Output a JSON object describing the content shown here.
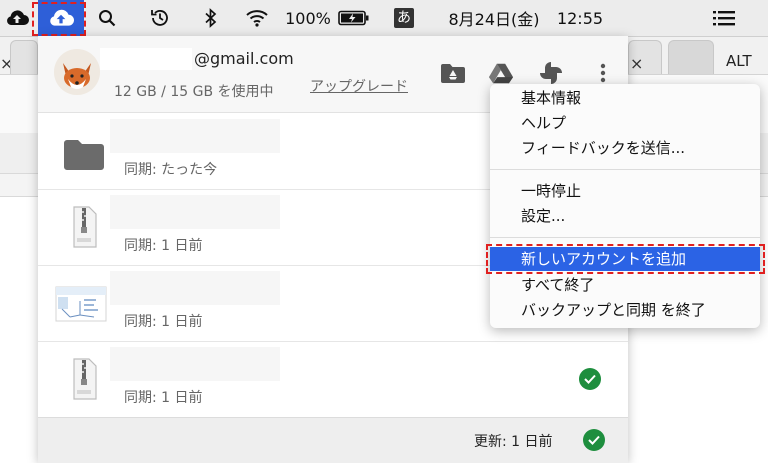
{
  "menubar": {
    "wifi_label": "100%",
    "input_method": "あ",
    "date": "8月24日(金)",
    "time": "12:55"
  },
  "browser": {
    "tab_close_left": "×",
    "tab_close_right": "×",
    "alt_label": "ALT"
  },
  "account": {
    "email_suffix": "@gmail.com",
    "storage": "12 GB / 15 GB を使用中",
    "upgrade": "アップグレード"
  },
  "files": [
    {
      "type": "folder",
      "status": "同期: たった今",
      "synced": false
    },
    {
      "type": "zip",
      "status": "同期: 1 日前",
      "synced": false
    },
    {
      "type": "image",
      "status": "同期: 1 日前",
      "synced": false
    },
    {
      "type": "zip",
      "status": "同期: 1 日前",
      "synced": true
    }
  ],
  "footer": {
    "updated": "更新: 1 日前"
  },
  "context_menu": {
    "items": [
      {
        "label": "基本情報"
      },
      {
        "label": "ヘルプ"
      },
      {
        "label": "フィードバックを送信..."
      },
      {
        "label": "一時停止"
      },
      {
        "label": "設定..."
      },
      {
        "label": "新しいアカウントを追加",
        "active": true
      },
      {
        "label": "すべて終了"
      },
      {
        "label": "バックアップと同期 を終了"
      }
    ]
  },
  "colors": {
    "highlight": "#2b63e5",
    "callout": "#e02020",
    "success": "#1e8e3e"
  },
  "icons": [
    "cloud-upload-icon",
    "backup-sync-icon",
    "search-icon",
    "time-machine-icon",
    "bluetooth-icon",
    "wifi-icon",
    "battery-icon",
    "menu-list-icon",
    "drive-folder-icon",
    "google-drive-icon",
    "google-photos-icon",
    "more-vert-icon",
    "folder-icon",
    "zip-file-icon",
    "image-thumbnail-icon",
    "check-icon"
  ]
}
